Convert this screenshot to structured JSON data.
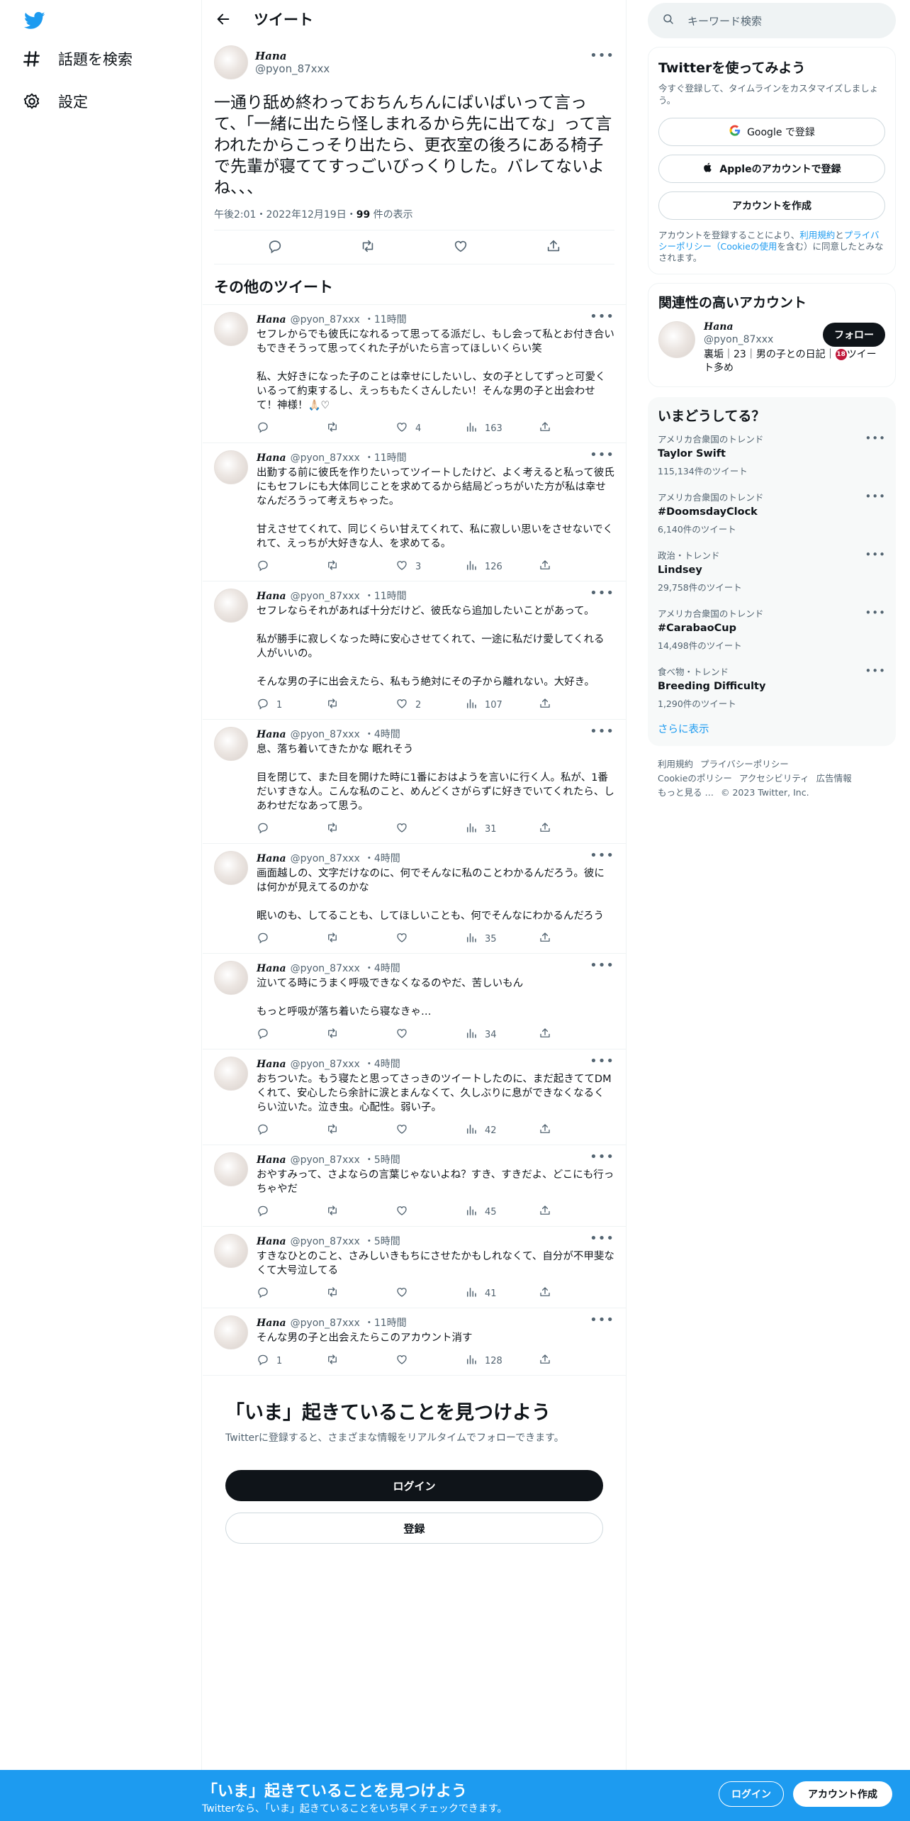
{
  "colors": {
    "brand": "#1d9bf0",
    "text": "#0f1419",
    "muted": "#536471"
  },
  "nav": {
    "logo_icon": "twitter-bird-icon",
    "items": [
      {
        "icon": "hashtag-icon",
        "label": "話題を検索"
      },
      {
        "icon": "gear-icon",
        "label": "設定"
      }
    ]
  },
  "header": {
    "title": "ツイート",
    "back_icon": "arrow-left-icon"
  },
  "focus_tweet": {
    "name": "Hana",
    "handle": "@pyon_87xxx",
    "text": "一通り舐め終わっておちんちんにばいばいって言って、「一緒に出たら怪しまれるから先に出てな」って言われたからこっそり出たら、更衣室の後ろにある椅子で先輩が寝ててすっごいびっくりした。バレてないよね、、、",
    "time": "午後2:01・2022年12月19日・",
    "views": "99",
    "views_label": " 件の表示"
  },
  "more_tweets_title": "その他のツイート",
  "tweets": [
    {
      "name": "Hana",
      "handle": "@pyon_87xxx",
      "time": "・11時間",
      "text": "セフレからでも彼氏になれるって思ってる派だし、もし会って私とお付き合いもできそうって思ってくれた子がいたら言ってほしいくらい笑\n\n私、大好きになった子のことは幸せにしたいし、女の子としてずっと可愛くいるって約束するし、えっちもたくさんしたい！そんな男の子と出会わせて！神様！🙏🏻♡",
      "replies": "",
      "retweets": "",
      "likes": "4",
      "views": "163"
    },
    {
      "name": "Hana",
      "handle": "@pyon_87xxx",
      "time": "・11時間",
      "text": "出勤する前に彼氏を作りたいってツイートしたけど、よく考えると私って彼氏にもセフレにも大体同じことを求めてるから結局どっちがいた方が私は幸せなんだろうって考えちゃった。\n\n甘えさせてくれて、同じくらい甘えてくれて、私に寂しい思いをさせないでくれて、えっちが大好きな人、を求めてる。",
      "replies": "",
      "retweets": "",
      "likes": "3",
      "views": "126"
    },
    {
      "name": "Hana",
      "handle": "@pyon_87xxx",
      "time": "・11時間",
      "text": "セフレならそれがあれば十分だけど、彼氏なら追加したいことがあって。\n\n私が勝手に寂しくなった時に安心させてくれて、一途に私だけ愛してくれる人がいいの。\n\nそんな男の子に出会えたら、私もう絶対にその子から離れない。大好き。",
      "replies": "1",
      "retweets": "",
      "likes": "2",
      "views": "107"
    },
    {
      "name": "Hana",
      "handle": "@pyon_87xxx",
      "time": "・4時間",
      "text": "息、落ち着いてきたかな 眠れそう\n\n目を閉じて、また目を開けた時に1番におはようを言いに行く人。私が、1番だいすきな人。こんな私のこと、めんどくさがらずに好きでいてくれたら、しあわせだなあって思う。",
      "replies": "",
      "retweets": "",
      "likes": "",
      "views": "31"
    },
    {
      "name": "Hana",
      "handle": "@pyon_87xxx",
      "time": "・4時間",
      "text": "画面越しの、文字だけなのに、何でそんなに私のことわかるんだろう。彼には何かが見えてるのかな\n\n眠いのも、してることも、してほしいことも、何でそんなにわかるんだろう",
      "replies": "",
      "retweets": "",
      "likes": "",
      "views": "35"
    },
    {
      "name": "Hana",
      "handle": "@pyon_87xxx",
      "time": "・4時間",
      "text": "泣いてる時にうまく呼吸できなくなるのやだ、苦しいもん\n\nもっと呼吸が落ち着いたら寝なきゃ…",
      "replies": "",
      "retweets": "",
      "likes": "",
      "views": "34"
    },
    {
      "name": "Hana",
      "handle": "@pyon_87xxx",
      "time": "・4時間",
      "text": "おちついた。もう寝たと思ってさっきのツイートしたのに、まだ起きててDMくれて、安心したら余計に涙とまんなくて、久しぶりに息ができなくなるくらい泣いた。泣き虫。心配性。弱い子。",
      "replies": "",
      "retweets": "",
      "likes": "",
      "views": "42"
    },
    {
      "name": "Hana",
      "handle": "@pyon_87xxx",
      "time": "・5時間",
      "text": "おやすみって、さよならの言葉じゃないよね？すき、すきだよ、どこにも行っちゃやだ",
      "replies": "",
      "retweets": "",
      "likes": "",
      "views": "45"
    },
    {
      "name": "Hana",
      "handle": "@pyon_87xxx",
      "time": "・5時間",
      "text": "すきなひとのこと、さみしいきもちにさせたかもしれなくて、自分が不甲斐なくて大号泣してる",
      "replies": "",
      "retweets": "",
      "likes": "",
      "views": "41"
    },
    {
      "name": "Hana",
      "handle": "@pyon_87xxx",
      "time": "・11時間",
      "text": "そんな男の子と出会えたらこのアカウント消す",
      "replies": "1",
      "retweets": "",
      "likes": "",
      "views": "128"
    }
  ],
  "cta": {
    "title": "「いま」起きていることを見つけよう",
    "subtitle": "Twitterに登録すると、さまざまな情報をリアルタイムでフォローできます。",
    "login": "ログイン",
    "signup": "登録"
  },
  "search": {
    "placeholder": "キーワード検索"
  },
  "join": {
    "title": "Twitterを使ってみよう",
    "sub": "今すぐ登録して、タイムラインをカスタマイズしましょう。",
    "google": "Google で登録",
    "apple": "Appleのアカウントで登録",
    "create": "アカウントを作成",
    "legal_1": "アカウントを登録することにより、",
    "legal_terms": "利用規約",
    "legal_2": "と",
    "legal_privacy": "プライバシーポリシー",
    "legal_cookie": "（Cookieの使用",
    "legal_3": "を含む）に同意したとみなされます。"
  },
  "related": {
    "title": "関連性の高いアカウント",
    "name": "Hana",
    "handle": "@pyon_87xxx",
    "bio_1": "裏垢｜23｜男の子との日記｜",
    "bio_badge": "18",
    "bio_2": "ツイート多め",
    "follow": "フォロー"
  },
  "trends": {
    "title": "いまどうしてる？",
    "items": [
      {
        "meta": "アメリカ合衆国のトレンド",
        "name": "Taylor Swift",
        "count": "115,134件のツイート"
      },
      {
        "meta": "アメリカ合衆国のトレンド",
        "name": "#DoomsdayClock",
        "count": "6,140件のツイート"
      },
      {
        "meta": "政治・トレンド",
        "name": "Lindsey",
        "count": "29,758件のツイート"
      },
      {
        "meta": "アメリカ合衆国のトレンド",
        "name": "#CarabaoCup",
        "count": "14,498件のツイート"
      },
      {
        "meta": "食べ物・トレンド",
        "name": "Breeding Difficulty",
        "count": "1,290件のツイート"
      }
    ],
    "show_more": "さらに表示"
  },
  "footer": {
    "terms": "利用規約",
    "privacy": "プライバシーポリシー",
    "cookie": "Cookieのポリシー",
    "accessibility": "アクセシビリティ",
    "ads": "広告情報",
    "more": "もっと見る …",
    "copyright": "© 2023 Twitter, Inc."
  },
  "bottom_bar": {
    "title": "「いま」起きていることを見つけよう",
    "sub": "Twitterなら、「いま」起きていることをいち早くチェックできます。",
    "login": "ログイン",
    "signup": "アカウント作成"
  }
}
